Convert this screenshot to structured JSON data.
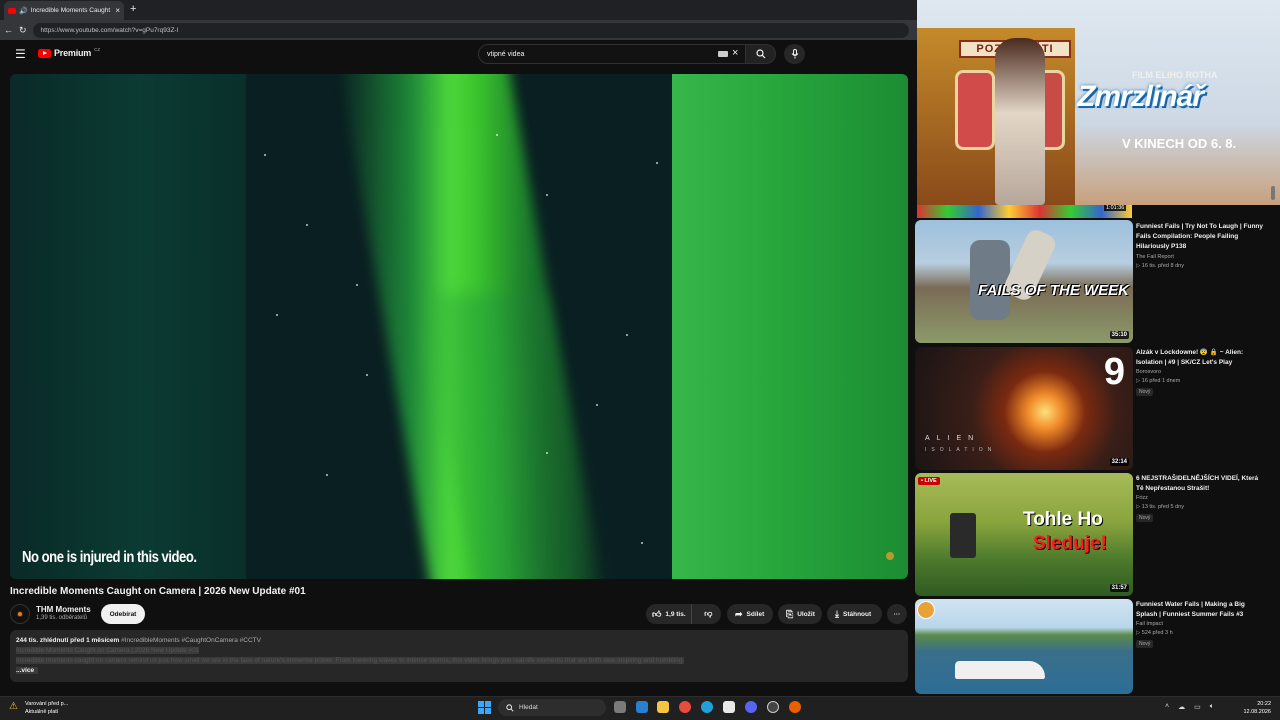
{
  "browser": {
    "tab_title": "Incredible Moments Caught o",
    "tab_close": "×",
    "new_tab": "+",
    "url": "https://www.youtube.com/watch?v=gPu7rq93Z-I",
    "back": "←",
    "reload": "↻"
  },
  "youtube": {
    "logo_text": "Premium",
    "logo_country": "CZ",
    "search_value": "vtipné videa",
    "clear_icon": "×"
  },
  "player": {
    "caption": "No one is injured in this video."
  },
  "video": {
    "title": "Incredible Moments Caught on Camera | 2026 New Update #01",
    "channel": "THM Moments",
    "subscribers": "1,39 tis. odběratelů",
    "subscribe_label": "Odebírat",
    "likes": "1,9 tis.",
    "share_label": "Sdílet",
    "save_label": "Uložit",
    "download_label": "Stáhnout",
    "more": "···"
  },
  "description": {
    "meta": "244 tis. zhlédnutí  před 1 měsícem",
    "tags": "#IncredibleMoments #CaughtOnCamera #CCTV",
    "line1": "Incredible Moments Caught on Camera | 2026 New Update #01",
    "line2": "Incredible moments caught on camera remind us just how small we are in the face of nature's immense power. From towering waves to intense storms, this video brings you real-life moments that are both awe-inspiring and humbling.",
    "more_label": "...více"
  },
  "ad": {
    "sign": "POZOR DĚTI",
    "film_by": "FILM ELIHO ROTHA",
    "title": "Zmrzlinář",
    "subtitle": "V KINECH OD 6. 8."
  },
  "recommended": {
    "strip_duration": "1:01:36",
    "items": [
      {
        "title": "Funniest Fails | Try Not To Laugh | Funny Fails Compilation: People Failing Hilariously P138",
        "channel": "The Fail Report",
        "views": "▷ 16 tis.  před 8 dny",
        "duration": "35:10",
        "thumb_text": "FAILS OF THE WEEK",
        "badge": ""
      },
      {
        "title": "Alzák v Lockdowne! 😨 🔒 ~ Alien: Isolation | #9 | SK/CZ Let's Play",
        "channel": "Borosvoro",
        "views": "▷ 16  před 1 dnem",
        "duration": "32:14",
        "thumb_text": "9",
        "thumb_text2": "ALIEN",
        "thumb_text3": "ISOLATION",
        "badge": "Nový"
      },
      {
        "title": "6 NEJSTRAŠIDELNĚJŠÍCH VIDEÍ, Která Tě Nepřestanou Strašit!",
        "channel": "Frizz",
        "views": "▷ 13 tis.  před 5 dny",
        "duration": "31:57",
        "thumb_text": "Tohle Ho",
        "thumb_text2": "Sleduje!",
        "live": "• LIVE",
        "badge": "Nový"
      },
      {
        "title": "Funniest Water Fails | Making a Big Splash | Funniest Summer Fails #3",
        "channel": "Fail Impact",
        "views": "▷ 524  před 3 h",
        "duration": "",
        "badge": "Nový"
      }
    ]
  },
  "taskbar": {
    "notification_line1": "Varování před p...",
    "notification_line2": "Aktuálně platí",
    "search_label": "Hledat",
    "time": "20:22",
    "date": "12.08.2026"
  },
  "colors": {
    "yt_red": "#ff0000",
    "background": "#0f0f0f",
    "accent_blue": "#3ba7f5"
  }
}
